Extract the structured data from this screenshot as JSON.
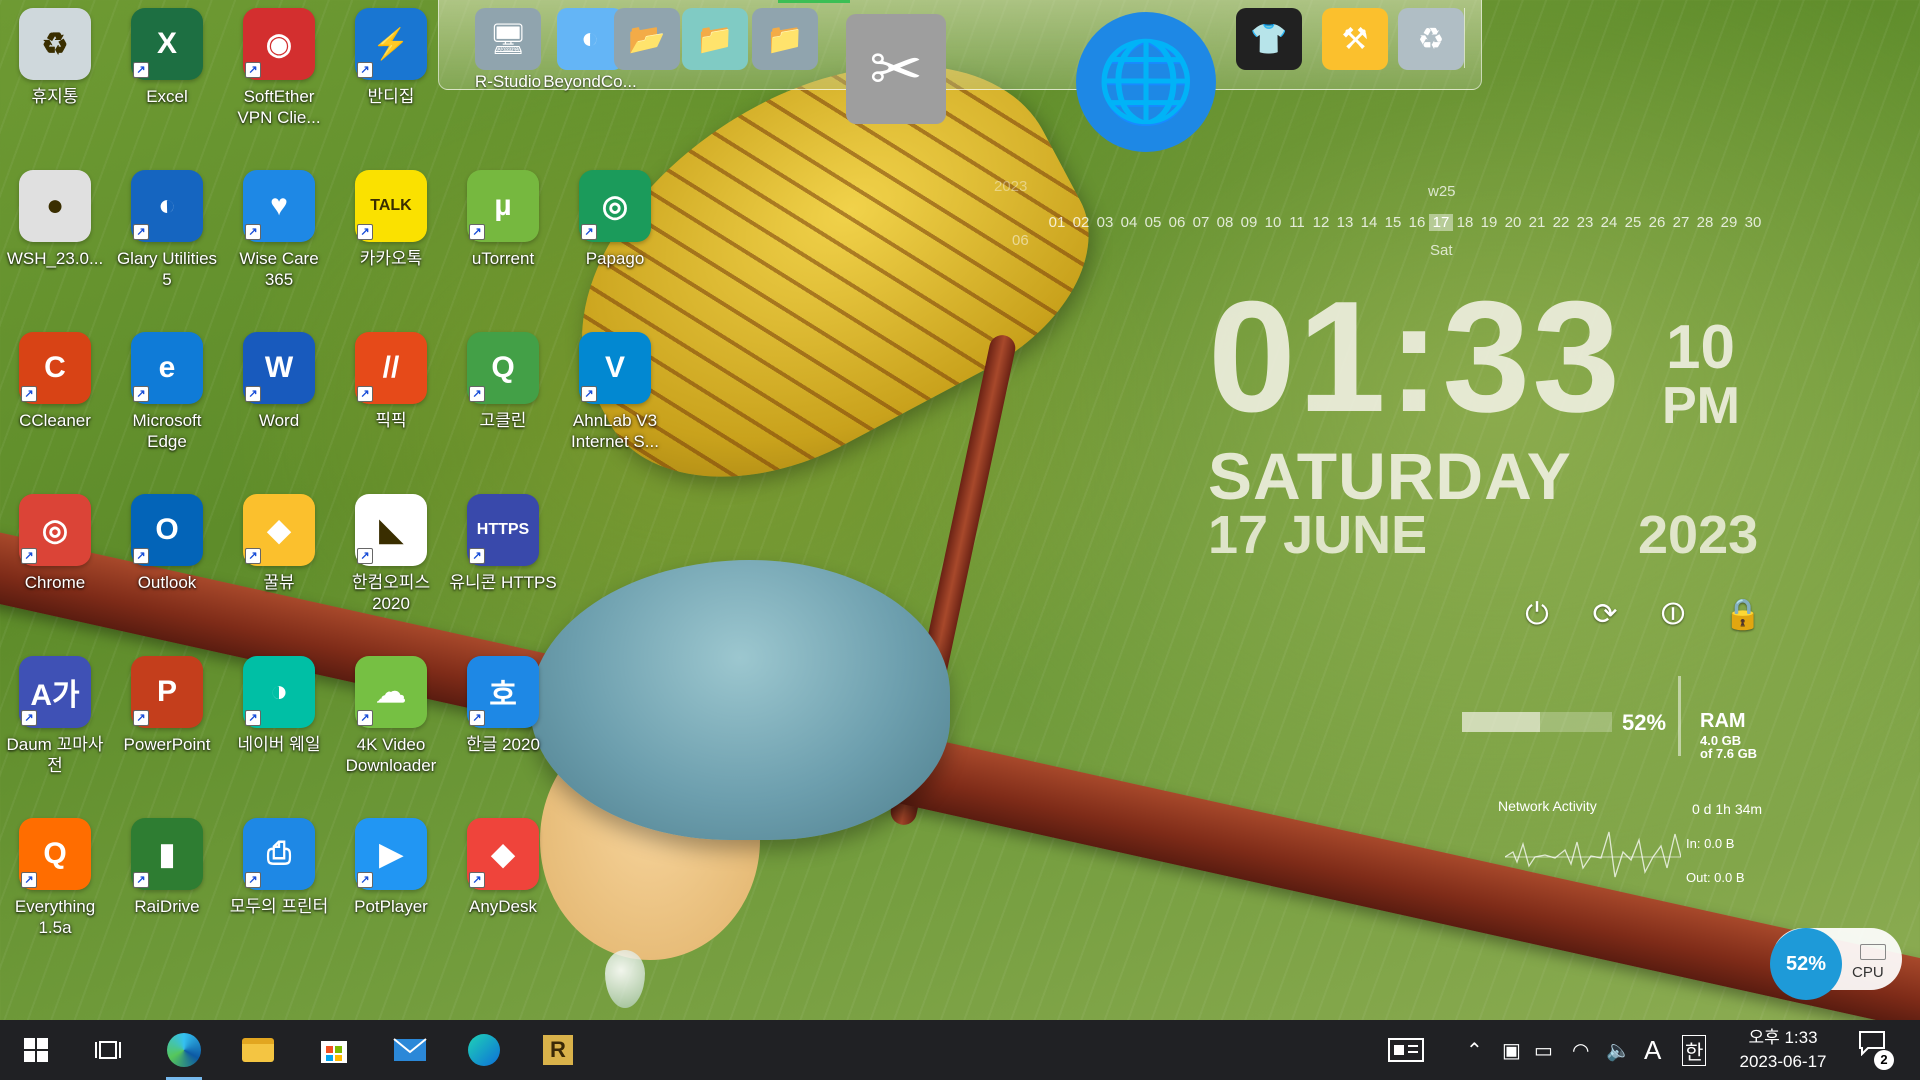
{
  "desktop_icons": [
    {
      "label": "휴지통",
      "icon": "recycle-bin-icon",
      "color": "#cfd8dc",
      "glyph": "♻"
    },
    {
      "label": "Excel",
      "icon": "excel-icon",
      "color": "#1d6f42",
      "glyph": "X"
    },
    {
      "label": "SoftEther VPN Clie...",
      "icon": "softether-vpn-icon",
      "color": "#d32f2f",
      "glyph": "◉"
    },
    {
      "label": "반디집",
      "icon": "bandizip-icon",
      "color": "#1976d2",
      "glyph": "⚡"
    },
    {
      "label": "WSH_23.0...",
      "icon": "file-icon",
      "color": "#e0e0e0",
      "glyph": "●"
    },
    {
      "label": "Glary Utilities 5",
      "icon": "glary-utilities-icon",
      "color": "#1565c0",
      "glyph": "◐"
    },
    {
      "label": "Wise Care 365",
      "icon": "wise-care-icon",
      "color": "#1e88e5",
      "glyph": "♥"
    },
    {
      "label": "카카오톡",
      "icon": "kakaotalk-icon",
      "color": "#fae100",
      "glyph": "TALK"
    },
    {
      "label": "uTorrent",
      "icon": "utorrent-icon",
      "color": "#76b83f",
      "glyph": "µ"
    },
    {
      "label": "Papago",
      "icon": "papago-icon",
      "color": "#1b9b5b",
      "glyph": "◎"
    },
    {
      "label": "CCleaner",
      "icon": "ccleaner-icon",
      "color": "#d84315",
      "glyph": "C"
    },
    {
      "label": "Microsoft Edge",
      "icon": "edge-icon",
      "color": "#0f7bd7",
      "glyph": "e"
    },
    {
      "label": "Word",
      "icon": "word-icon",
      "color": "#185abd",
      "glyph": "W"
    },
    {
      "label": "픽픽",
      "icon": "picpick-icon",
      "color": "#e64a19",
      "glyph": "//"
    },
    {
      "label": "고클린",
      "icon": "goclean-icon",
      "color": "#43a047",
      "glyph": "Q"
    },
    {
      "label": "AhnLab V3 Internet S...",
      "icon": "ahnlab-v3-icon",
      "color": "#0288d1",
      "glyph": "V"
    },
    {
      "label": "Chrome",
      "icon": "chrome-icon",
      "color": "#db4437",
      "glyph": "◎"
    },
    {
      "label": "Outlook",
      "icon": "outlook-icon",
      "color": "#0364b8",
      "glyph": "O"
    },
    {
      "label": "꿀뷰",
      "icon": "honeyview-icon",
      "color": "#fbc02d",
      "glyph": "◆"
    },
    {
      "label": "한컴오피스 2020",
      "icon": "hancom-office-icon",
      "color": "#ffffff",
      "glyph": "◣"
    },
    {
      "label": "유니콘 HTTPS",
      "icon": "unicorn-https-icon",
      "color": "#3949ab",
      "glyph": "HTTPS"
    },
    {
      "label": "Daum 꼬마사전",
      "icon": "daum-dictionary-icon",
      "color": "#3f51b5",
      "glyph": "A가"
    },
    {
      "label": "PowerPoint",
      "icon": "powerpoint-icon",
      "color": "#c43e1c",
      "glyph": "P"
    },
    {
      "label": "네이버 웨일",
      "icon": "naver-whale-icon",
      "color": "#00bfa5",
      "glyph": "◑"
    },
    {
      "label": "4K Video Downloader",
      "icon": "4k-video-downloader-icon",
      "color": "#76c043",
      "glyph": "☁"
    },
    {
      "label": "한글 2020",
      "icon": "hangul-icon",
      "color": "#1e88e5",
      "glyph": "호"
    },
    {
      "label": "Everything 1.5a",
      "icon": "everything-search-icon",
      "color": "#ff6d00",
      "glyph": "Q"
    },
    {
      "label": "RaiDrive",
      "icon": "raidrive-icon",
      "color": "#2e7d32",
      "glyph": "▮"
    },
    {
      "label": "모두의 프린터",
      "icon": "printer-icon",
      "color": "#1e88e5",
      "glyph": "⎙"
    },
    {
      "label": "PotPlayer",
      "icon": "potplayer-icon",
      "color": "#2196f3",
      "glyph": "▶"
    },
    {
      "label": "AnyDesk",
      "icon": "anydesk-icon",
      "color": "#ef443b",
      "glyph": "◆"
    }
  ],
  "dock": {
    "items": [
      {
        "label": "R-Studio",
        "icon": "r-studio-icon",
        "glyph": "🖥",
        "color": "#90a4ae"
      },
      {
        "label": "BeyondCo...",
        "icon": "beyond-compare-icon",
        "glyph": "◐",
        "color": "#64b5f6"
      },
      {
        "label": "",
        "icon": "folder-icon",
        "glyph": "📂",
        "color": "#90a4ae"
      },
      {
        "label": "",
        "icon": "folder-icon",
        "glyph": "📁",
        "color": "#80cbc4"
      },
      {
        "label": "",
        "icon": "folder-icon",
        "glyph": "📁",
        "color": "#90a4ae"
      },
      {
        "label": "",
        "icon": "tools-icon",
        "glyph": "✂",
        "color": "#9e9e9e"
      },
      {
        "label": "",
        "icon": "globe-icon",
        "glyph": "🌐",
        "color": "#1e88e5"
      },
      {
        "label": "",
        "icon": "tshirt-icon",
        "glyph": "👕",
        "color": "#212121"
      },
      {
        "label": "",
        "icon": "hammer-icon",
        "glyph": "⚒",
        "color": "#fbc02d"
      },
      {
        "label": "",
        "icon": "recycle-bin-icon",
        "glyph": "♻",
        "color": "#b0bec5"
      }
    ]
  },
  "calendar": {
    "year": "2023",
    "month": "06",
    "week": "w25",
    "days": [
      "01",
      "02",
      "03",
      "04",
      "05",
      "06",
      "07",
      "08",
      "09",
      "10",
      "11",
      "12",
      "13",
      "14",
      "15",
      "16",
      "17",
      "18",
      "19",
      "20",
      "21",
      "22",
      "23",
      "24",
      "25",
      "26",
      "27",
      "28",
      "29",
      "30"
    ],
    "today_index": 16,
    "today_dow": "Sat"
  },
  "clock": {
    "time": "01:33",
    "seconds": "10",
    "ampm": "PM",
    "day": "SATURDAY",
    "date": "17 JUNE",
    "year": "2023"
  },
  "power_controls": [
    {
      "name": "power-icon",
      "glyph": "⏻"
    },
    {
      "name": "restart-icon",
      "glyph": "⟳"
    },
    {
      "name": "standby-icon",
      "glyph": "⏼"
    },
    {
      "name": "lock-icon",
      "glyph": "🔒"
    }
  ],
  "ram": {
    "percent": 52,
    "percent_label": "52%",
    "title": "RAM",
    "used": "4.0 GB",
    "total": "of 7.6 GB"
  },
  "network": {
    "title": "Network Activity",
    "uptime": "0 d 1h 34m",
    "in": "In: 0.0 B",
    "out": "Out: 0.0 B"
  },
  "cpu_widget": {
    "percent_label": "52%",
    "label": "CPU",
    "color": "#1e9ad8"
  },
  "taskbar": {
    "clock_line1": "오후 1:33",
    "clock_line2": "2023-06-17",
    "ime_letter": "A",
    "ime_lang": "한",
    "notification_count": "2"
  }
}
